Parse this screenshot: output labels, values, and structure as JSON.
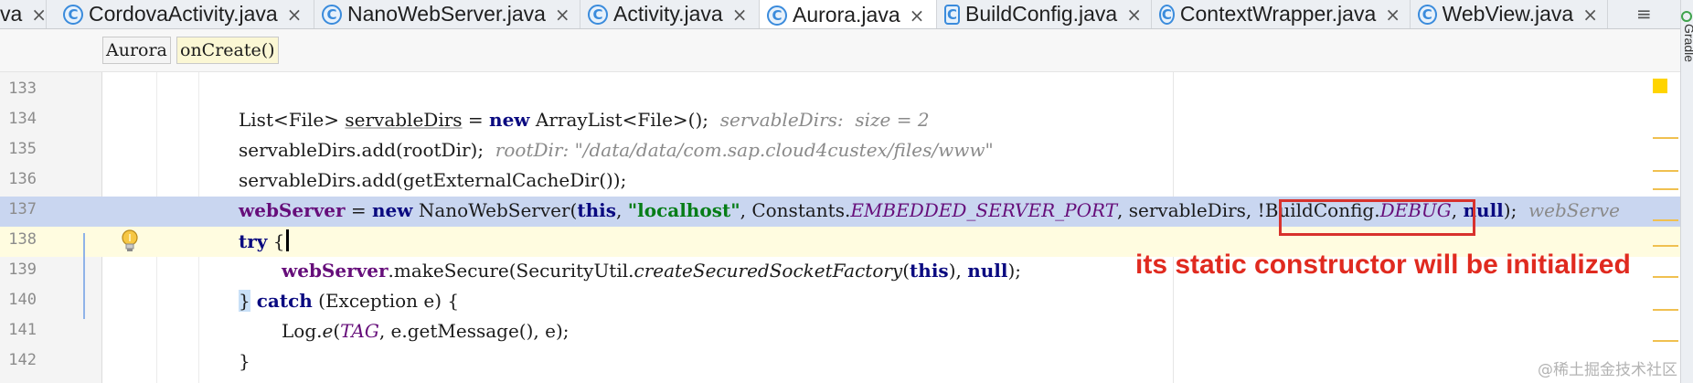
{
  "tabs": [
    {
      "label": "va",
      "icon": "",
      "active": false
    },
    {
      "label": "CordovaActivity.java",
      "icon": "C",
      "active": false
    },
    {
      "label": "NanoWebServer.java",
      "icon": "C",
      "active": false
    },
    {
      "label": "Activity.java",
      "icon": "C",
      "active": false
    },
    {
      "label": "Aurora.java",
      "icon": "C",
      "active": true
    },
    {
      "label": "BuildConfig.java",
      "icon": "C",
      "active": false
    },
    {
      "label": "ContextWrapper.java",
      "icon": "C",
      "active": false
    },
    {
      "label": "WebView.java",
      "icon": "C",
      "active": false
    }
  ],
  "tab_close_glyph": "×",
  "tab_menu_glyph": "≡",
  "breadcrumb": {
    "class_name": "Aurora",
    "method_name": "onCreate()"
  },
  "line_numbers": [
    "133",
    "134",
    "135",
    "136",
    "137",
    "138",
    "139",
    "140",
    "141",
    "142"
  ],
  "code": {
    "l134": {
      "t1": "List<File> ",
      "t2": "servableDirs",
      "t3": " = ",
      "t4": "new",
      "t5": " ArrayList<File>();",
      "hint": "servableDirs:  size = 2"
    },
    "l135": {
      "t1": "servableDirs.add(rootDir);",
      "hint": "rootDir: \"/data/data/com.sap.cloud4custex/files/www\""
    },
    "l136": {
      "t1": "servableDirs.add(getExternalCacheDir());"
    },
    "l137": {
      "t1": "webServer",
      "t2": " = ",
      "t3": "new",
      "t4": " NanoWebServer(",
      "t5": "this",
      "t6": ", ",
      "t7": "\"localhost\"",
      "t8": ", Constants.",
      "t9": "EMBEDDED_SERVER_PORT",
      "t10": ", servableDirs, !BuildConfig.",
      "t11": "DEBUG",
      "t12": ", ",
      "t13": "null",
      "t14": ");",
      "hint": "webServe"
    },
    "l138": {
      "t1": "try",
      "t2": " {"
    },
    "l139": {
      "t1": "webServer",
      "t2": ".makeSecure(SecurityUtil.",
      "t3": "createSecuredSocketFactory",
      "t4": "(",
      "t5": "this",
      "t6": "), ",
      "t7": "null",
      "t8": ");"
    },
    "l140": {
      "t1": "}",
      "t2": " catch",
      "t3": " (Exception e) {"
    },
    "l141": {
      "t1": "Log.",
      "t2": "e",
      "t3": "(",
      "t4": "TAG",
      "t5": ", e.getMessage(), e);"
    },
    "l142": {
      "t1": "}"
    }
  },
  "annotation_text": "its static constructor will be initialized",
  "watermark": "@稀土掘金技术社区",
  "side_tool": "Gradle",
  "colors": {
    "highlight_line": "#c9d6f0",
    "annotation": "#e02a1f",
    "box": "#d8322d"
  }
}
